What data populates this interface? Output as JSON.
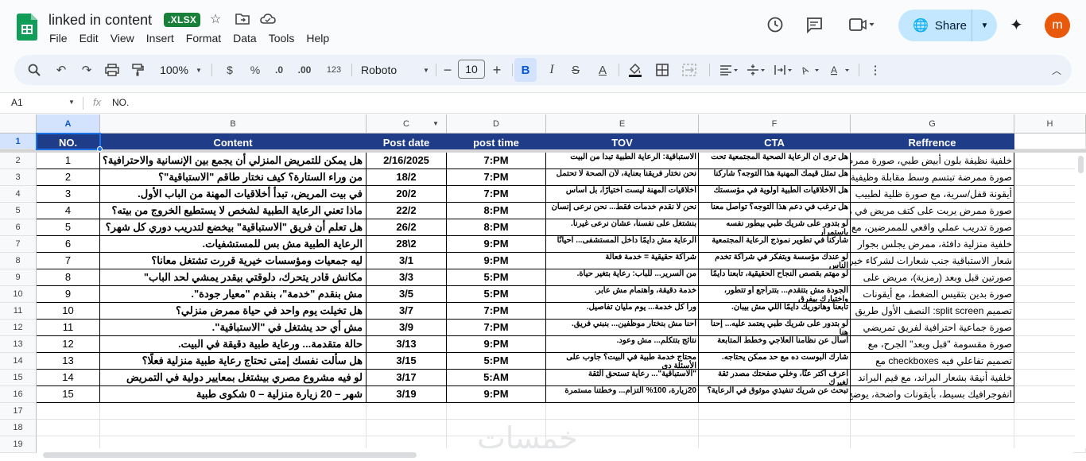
{
  "app": {
    "doc_title": "linked in content",
    "badge": ".XLSX",
    "menu": [
      "File",
      "Edit",
      "View",
      "Insert",
      "Format",
      "Data",
      "Tools",
      "Help"
    ],
    "share_label": "Share",
    "avatar_letter": "m"
  },
  "toolbar": {
    "zoom": "100%",
    "currency": "$",
    "percent": "%",
    "number_format": "123",
    "font": "Roboto",
    "font_size": "10"
  },
  "formula_bar": {
    "name_box": "A1",
    "fx": "fx",
    "value": "NO."
  },
  "columns": [
    "A",
    "B",
    "C",
    "D",
    "E",
    "F",
    "G",
    "H"
  ],
  "row_numbers": [
    "1",
    "2",
    "3",
    "4",
    "5",
    "6",
    "7",
    "8",
    "9",
    "10",
    "11",
    "12",
    "13",
    "14",
    "15",
    "16",
    "17",
    "18",
    "19"
  ],
  "headers": [
    "NO.",
    "Content",
    "Post date",
    "post time",
    "TOV",
    "CTA",
    "Reffrence"
  ],
  "rows": [
    {
      "no": "1",
      "content": "هل يمكن للتمريض المنزلي أن يجمع بين الإنسانية والاحترافية؟",
      "date": "2/16/2025",
      "time": "7:PM",
      "tov": "الاستباقية: الرعاية الطبية تبدأ من البيت",
      "cta": "هل ترى أن الرعاية الصحية المجتمعية تحت",
      "ref": "خلفية نظيفة بلون أبيض طبي، صورة ممرض"
    },
    {
      "no": "2",
      "content": "من وراء الستارة؟ كيف نختار طاقم \"الاستباقية\"؟",
      "date": "18/2",
      "time": "7:PM",
      "tov": "نحن نختار فريقنا بعناية، لأن الصحة لا تحتمل",
      "cta": "هل تمثل قيمك المهنية هذا التوجه؟ شاركنا",
      "ref": "صورة ممرضة تبتسم وسط مقابلة وظيفية"
    },
    {
      "no": "3",
      "content": "في بيت المريض، تبدأ أخلاقيات المهنة من الباب الأول.",
      "date": "20/2",
      "time": "7:PM",
      "tov": "أخلاقيات المهنة ليست اختيارًا، بل أساس",
      "cta": "هل الأخلاقيات الطبية أولوية في مؤسستك",
      "ref": "أيقونة قفل/سرية، مع صورة ظلية لطبيب"
    },
    {
      "no": "4",
      "content": "ماذا تعني الرعاية الطبية لشخص لا يستطيع الخروج من بيته؟",
      "date": "22/2",
      "time": "8:PM",
      "tov": "نحن لا نقدم خدمات فقط... نحن نرعى إنسان",
      "cta": "هل ترغب في دعم هذا التوجه؟ تواصل معنا",
      "ref": "صورة ممرض يربت على كتف مريض في منزله"
    },
    {
      "no": "5",
      "content": "هل تعلم أن فريق \"الاستباقية\" بيخضع لتدريب دوري كل شهر؟",
      "date": "26/2",
      "time": "8:PM",
      "tov": "بنشتغل على نفسنا، عشان نرعى غيرنا.",
      "cta": "لو بتدور على شريك طبي بيطور نفسه باستمرار",
      "ref": "صورة تدريب عملي واقعي للممرضين، مع"
    },
    {
      "no": "6",
      "content": "الرعاية الطبية مش بس للمستشفيات.",
      "date": "28\\2",
      "time": "9:PM",
      "tov": "الرعاية مش دايمًا داخل المستشفى... أحيانًا",
      "cta": "شاركنا في تطوير نموذج الرعاية المجتمعية",
      "ref": "خلفية منزلية دافئة، ممرض يجلس بجوار"
    },
    {
      "no": "7",
      "content": "ليه جمعيات ومؤسسات خيرية قررت تشتغل معانا؟",
      "date": "3/1",
      "time": "9:PM",
      "tov": "شراكة حقيقية = خدمة فعالة",
      "cta": "لو عندك مؤسسة وبتفكر في شراكة تخدم الناس",
      "ref": "شعار الاستباقية جنب شعارات لشركاء خيريين"
    },
    {
      "no": "8",
      "content": "مكانش قادر يتحرك، دلوقتي بيقدر يمشي لحد الباب\"",
      "date": "3/3",
      "time": "5:PM",
      "tov": "من السرير... للباب: رعاية بتغير حياة.",
      "cta": "لو مهتم بقصص النجاح الحقيقية، تابعنا دايمًا",
      "ref": "صورتين قبل وبعد (رمزية)، مريض على"
    },
    {
      "no": "9",
      "content": "مش بنقدم \"خدمة\"، بنقدم \"معيار جودة\".",
      "date": "3/5",
      "time": "5:PM",
      "tov": "خدمة دقيقة، واهتمام مش عابر.",
      "cta": "الجودة مش بتتقدم... بتتراجع أو تتطور، واختيارك بيفرق",
      "ref": "صورة بدين بتقيس الضغط، مع أيقونات"
    },
    {
      "no": "10",
      "content": "هل تخيلت يوم واحد في حياة ممرض منزلي؟",
      "date": "3/7",
      "time": "7:PM",
      "tov": "ورا كل خدمة... يوم مليان تفاصيل.",
      "cta": "تابعنا وهانوريك دايمًا اللي مش بيبان.",
      "ref": "تصميم split screen: النصف الأول طريق"
    },
    {
      "no": "11",
      "content": "مش أي حد يشتغل في \"الاستباقية\".",
      "date": "3/9",
      "time": "7:PM",
      "tov": "احنا مش بنختار موظفين... بنبني فريق.",
      "cta": "لو بتدور على شريك طبي يعتمد عليه... إحنا هنا",
      "ref": "صورة جماعية احترافية لفريق تمريضي"
    },
    {
      "no": "12",
      "content": "حالة متقدمة... ورعاية طبية دقيقة في البيت.",
      "date": "3/13",
      "time": "9:PM",
      "tov": "نتائج بتتكلم... مش وعود.",
      "cta": "اسأل عن نظامنا العلاجي وخطط المتابعة",
      "ref": "صورة مقسومة \"قبل وبعد\" الجرح، مع"
    },
    {
      "no": "13",
      "content": "هل سألت نفسك إمتى تحتاج رعاية طبية منزلية فعلًا؟",
      "date": "3/15",
      "time": "5:PM",
      "tov": "محتاج خدمة طبية في البيت؟ جاوب على الأسئلة دي",
      "cta": "شارك البوست ده مع حد ممكن يحتاجه.",
      "ref": "تصميم تفاعلي فيه checkboxes مع"
    },
    {
      "no": "14",
      "content": "لو فيه مشروع مصري بيشتغل بمعايير دولية في التمريض",
      "date": "3/17",
      "time": "5:AM",
      "tov": "\"الاستباقية\"... رعاية تستحق الثقة",
      "cta": "اعرف أكتر عنّا، وخلّي صفحتك مصدر ثقة لغيرك",
      "ref": "خلفية أنيقة بشعار البراند، مع قيم البراند"
    },
    {
      "no": "15",
      "content": "شهر – 20 زيارة منزلية – 0 شكوى طبية",
      "date": "3/19",
      "time": "9:PM",
      "tov": "20زيارة، 100% التزام... وخطتنا مستمرة",
      "cta": "تبحث عن شريك تنفيذي موثوق في الرعاية؟",
      "ref": "انفوجرافيك بسيط، بأيقونات واضحة، يوضح"
    }
  ],
  "watermark": "خمسات"
}
